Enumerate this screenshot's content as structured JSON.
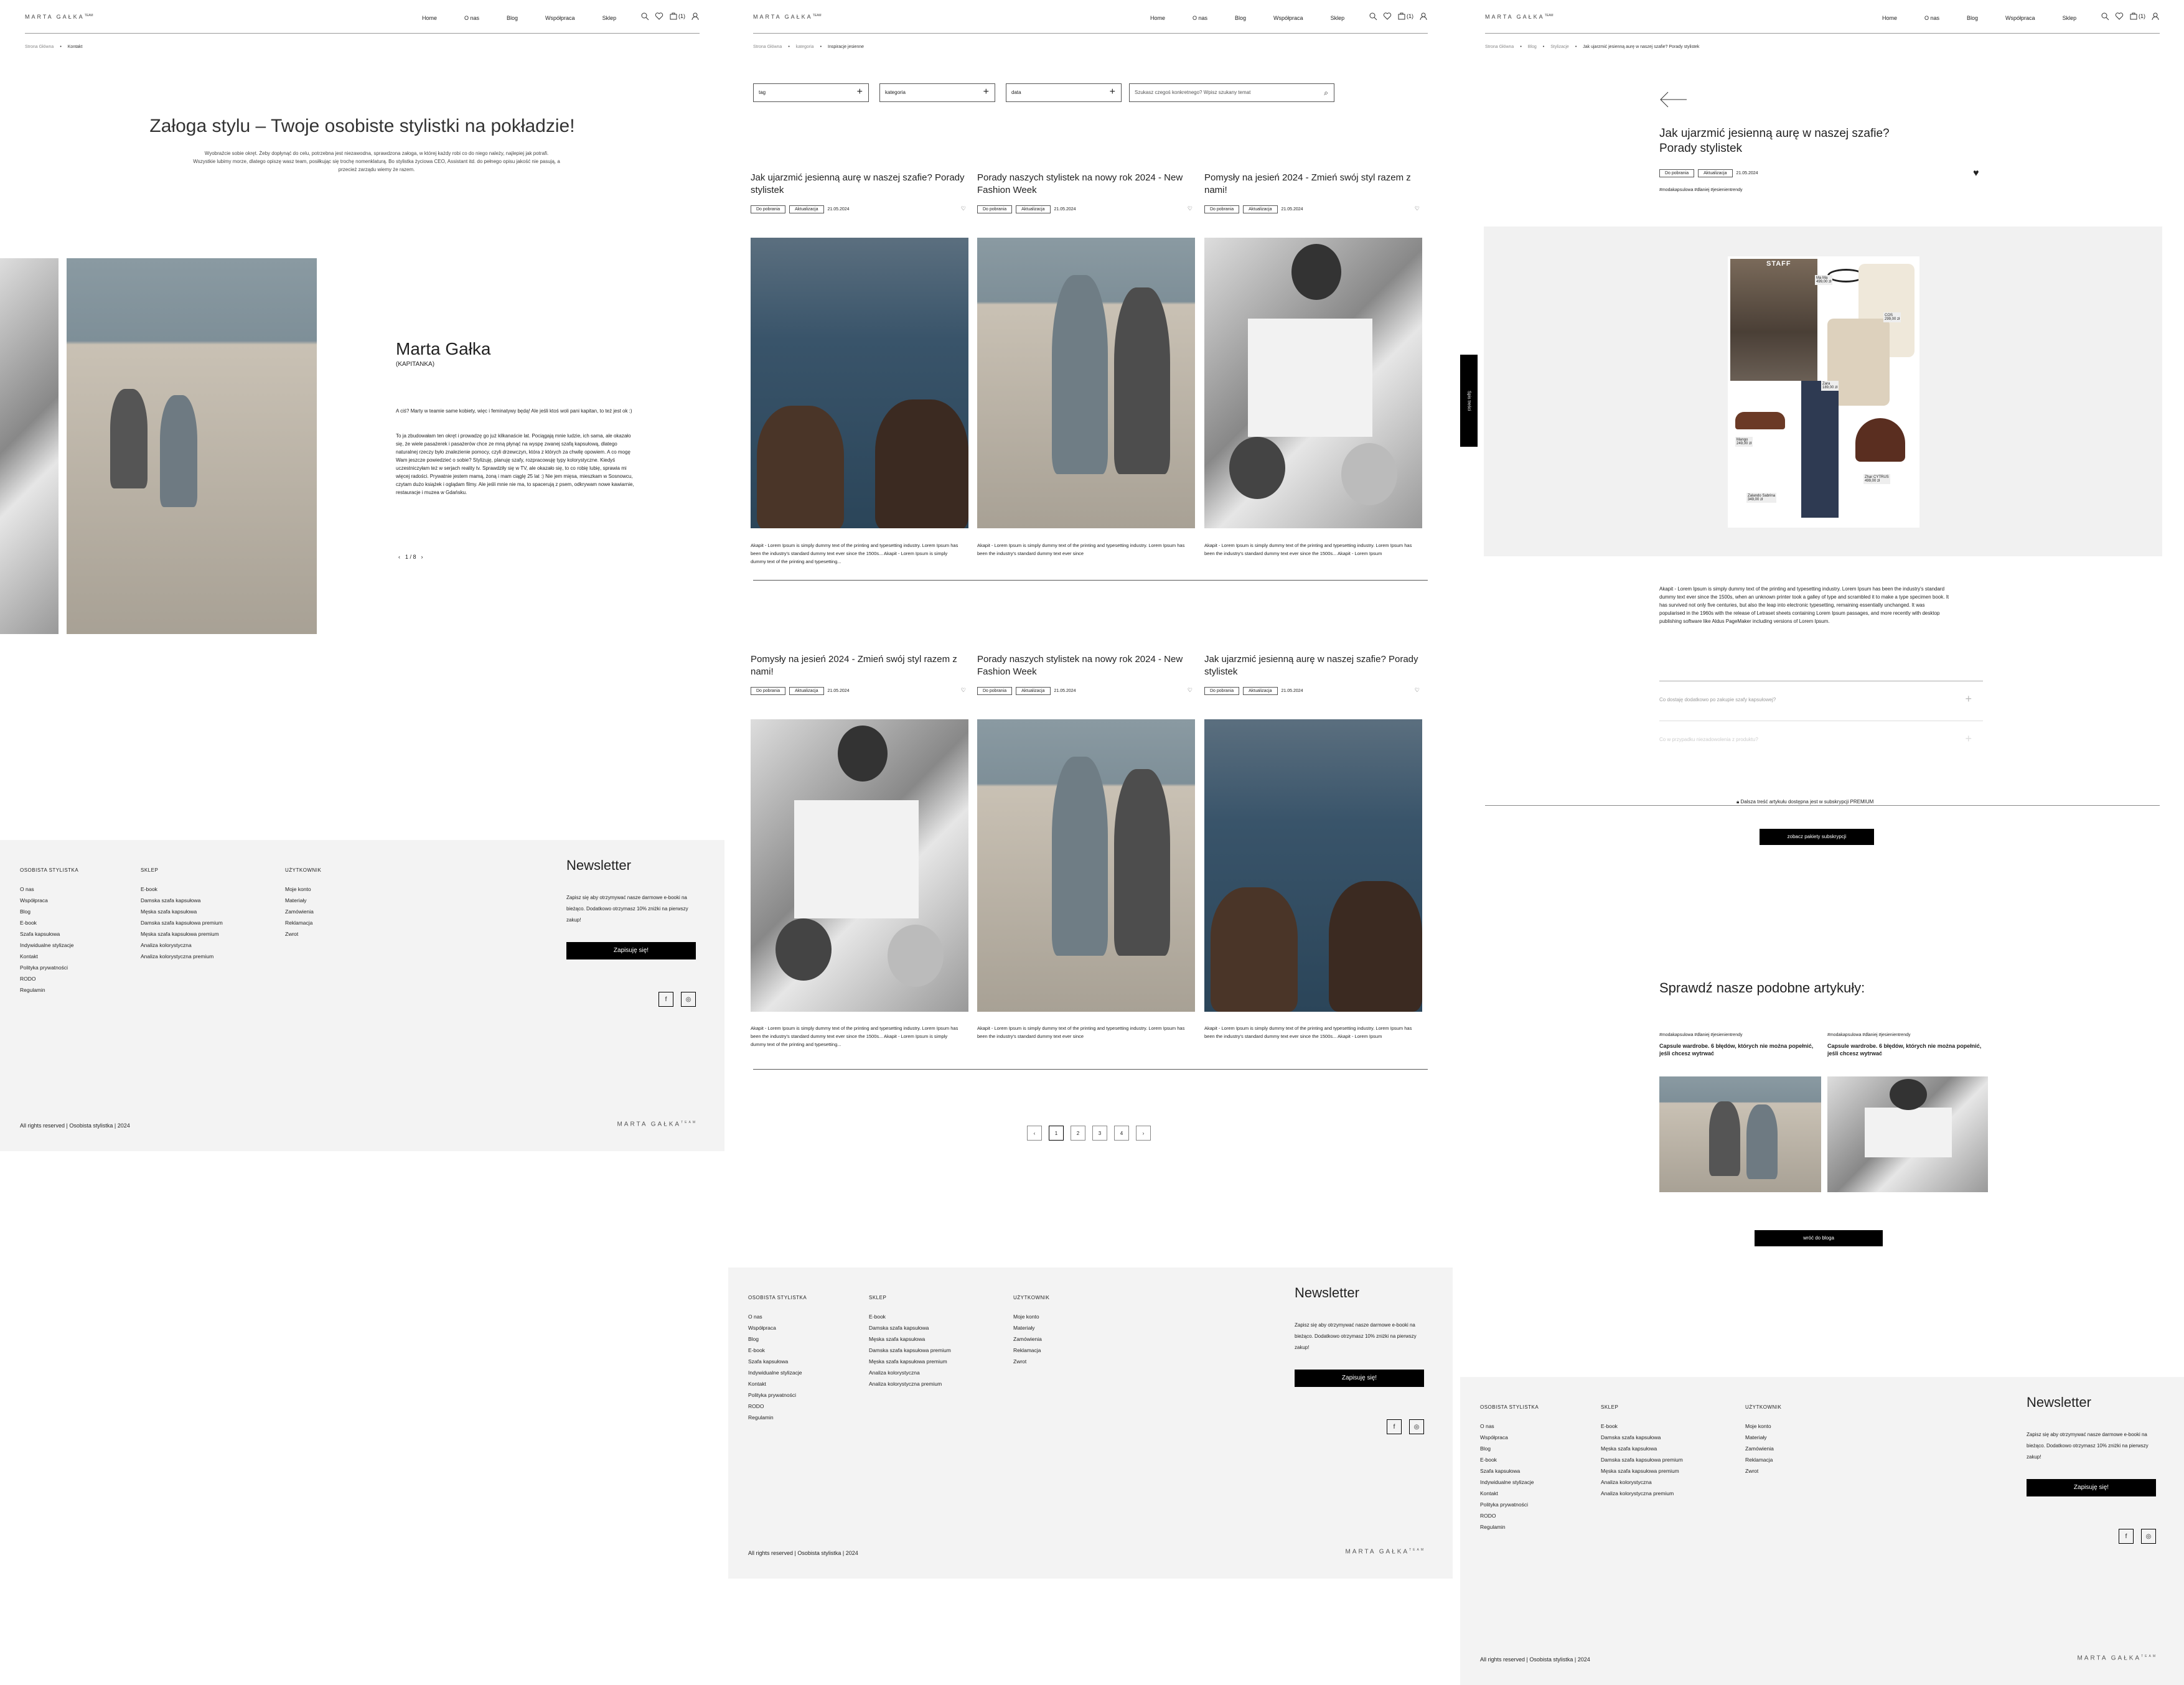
{
  "brand": {
    "logo": "MARTA GAŁKA",
    "logo_sup": "TEAM"
  },
  "nav": [
    "Home",
    "O nas",
    "Blog",
    "Współpraca",
    "Sklep"
  ],
  "cart_count": "(1)",
  "page1": {
    "breadcrumb": [
      "Strona Główna",
      "Kontakt"
    ],
    "title": "Załoga stylu – Twoje osobiste stylistki na pokładzie!",
    "intro": "Wyobraźcie sobie okręt. Żeby dopłynąć do celu, potrzebna jest niezawodna, sprawdzona załoga, w której każdy robi co do niego należy, najlepiej jak potrafi. Wszystkie lubimy morze, dlatego opiszę wasz team, posiłkując się trochę nomenklaturą. Bo stylistka życiowa CEO, Assistant itd. do pełnego opisu jakość nie pasują, a przecież zarządu wiemy że razem.",
    "member_name": "Marta Gałka",
    "member_role": "(KAPITANKA)",
    "bio1": "A ciś? Marty w teamie same kobiety, więc i feminatywy będą! Ale jeśli ktoś woli pani kapitan, to też jest ok :)",
    "bio2": "To ja zbudowałam ten okręt i prowadzę go już kilkanaście lat. Pociągają mnie ludzie, ich sama, ale okazało się, że wiele pasażerek i pasażerów chce ze mną płynąć na wyspę zwanej szafą kapsułową, dlatego naturalnej rzeczy było znalezienie pomocy, czyli drzewczyn, która z których za chwilę opowiem. A co mogę Wam jeszcze powiedzieć o sobie? Stylizuję, planuję szafy, rozpracowuję typy kolorystyczne. Kiedyś uczestniczyłam też w serjach reality tv. Sprawdziły się w TV, ale okazało się, to co robię lubię, sprawia mi więcej radości. Prywatnie jestem mamą, żoną i mam ciąglę 25 lat :) Nie jem mięsa, mieszkam w Sosnowcu, czytam dużo książek i oglądam filmy. Ale jeśli mnie nie ma, to spacerują z psem, odkrywam nowe kawiarnie, restauracje i muzea w Gdańsku.",
    "slider_counter": "1 / 8"
  },
  "footer": {
    "col1_title": "OSOBISTA STYLISTKA",
    "col1": [
      "O nas",
      "Współpraca",
      "Blog",
      "E-book",
      "Szafa kapsułowa",
      "Indywidualne stylizacje",
      "Kontakt",
      "Polityka prywatności",
      "RODO",
      "Regulamin"
    ],
    "col2_title": "SKLEP",
    "col2": [
      "E-book",
      "Damska szafa kapsułowa",
      "Męska szafa kapsułowa",
      "Damska szafa kapsułowa premium",
      "Męska szafa kapsułowa premium",
      "Analiza kolorystyczna",
      "Analiza kolorystyczna premium"
    ],
    "col3_title": "UŻYTKOWNIK",
    "col3": [
      "Moje konto",
      "Materiały",
      "Zamówienia",
      "Reklamacja",
      "Zwrot"
    ],
    "nl_title": "Newsletter",
    "nl_desc": "Zapisz się aby otrzymywać nasze darmowe e-booki na bieżąco. Dodatkowo otrzymasz 10% zniżki na pierwszy zakup!",
    "nl_button": "Zapisuję się!",
    "social_fb": "f",
    "social_ig": "◎",
    "copyright": "All rights reserved | Osobista stylistka | 2024"
  },
  "page2": {
    "breadcrumb": [
      "Strona Główna",
      "kategoria",
      "Inspiracje jesienne"
    ],
    "filters": [
      "tag",
      "kategoria",
      "data"
    ],
    "search_placeholder": "Szukasz czegoś konkretnego? Wpisz szukany temat",
    "tag1": "Do pobrania",
    "tag2": "Aktualizacja",
    "date": "21.05.2024",
    "row1": [
      {
        "title": "Jak ujarzmić jesienną aurę w naszej szafie? Porady stylistek",
        "excerpt": "Akapit - Lorem Ipsum is simply dummy text of the printing and typesetting industry. Lorem Ipsum has been the industry's standard dummy text ever since the 1500s... Akapit - Lorem Ipsum is simply dummy text of the printing and typesetting..."
      },
      {
        "title": "Porady naszych stylistek na nowy rok 2024 - New Fashion Week",
        "excerpt": "Akapit - Lorem Ipsum is simply dummy text of the printing and typesetting industry. Lorem Ipsum has been the industry's standard dummy text ever since"
      },
      {
        "title": "Pomysły na jesień 2024 - Zmień swój styl razem z nami!",
        "excerpt": "Akapit - Lorem Ipsum is simply dummy text of the printing and typesetting industry. Lorem Ipsum has been the industry's standard dummy text ever since the 1500s... Akapit - Lorem Ipsum"
      }
    ],
    "row2": [
      {
        "title": "Pomysły na jesień 2024 - Zmień swój styl razem z nami!",
        "excerpt": "Akapit - Lorem Ipsum is simply dummy text of the printing and typesetting industry. Lorem Ipsum has been the industry's standard dummy text ever since the 1500s... Akapit - Lorem Ipsum is simply dummy text of the printing and typesetting..."
      },
      {
        "title": "Porady naszych stylistek na nowy rok 2024 - New Fashion Week",
        "excerpt": "Akapit - Lorem Ipsum is simply dummy text of the printing and typesetting industry. Lorem Ipsum has been the industry's standard dummy text ever since"
      },
      {
        "title": "Jak ujarzmić jesienną aurę w naszej szafie? Porady stylistek",
        "excerpt": "Akapit - Lorem Ipsum is simply dummy text of the printing and typesetting industry. Lorem Ipsum has been the industry's standard dummy text ever since the 1500s... Akapit - Lorem Ipsum"
      }
    ],
    "pages": [
      "‹",
      "1",
      "2",
      "3",
      "4",
      "›"
    ]
  },
  "page3": {
    "breadcrumb": [
      "Strona Główna",
      "Blog",
      "Stylizacje",
      "Jak ujarzmić jesienną aurę w naszej szafie? Porady stylistek"
    ],
    "title": "Jak ujarzmić jesienną aurę w naszej szafie? Porady stylistek",
    "tag1": "Do pobrania",
    "tag2": "Aktualizacja",
    "date": "21.05.2024",
    "hashtags": "#modakapsulowa #dlaniej #jesienientrendy",
    "side_tab": "Spis treści",
    "collage_labels": [
      "Ma Ma\n499,00 zł",
      "COS\n299,00 zł",
      "Zara\n189,00 zł",
      "Mango\n249,00 zł",
      "Zalando Sabrina\n349,00 zł",
      "Zhar CYTRUS\n499,00 zł"
    ],
    "collage_header": "STAFF",
    "body": "Akapit - Lorem Ipsum is simply dummy text of the printing and typesetting industry. Lorem Ipsum has been the industry's standard dummy text ever since the 1500s, when an unknown printer took a galley of type and scrambled it to make a type specimen book. It has survived not only five centuries, but also the leap into electronic typesetting, remaining essentially unchanged. It was popularised in the 1960s with the release of Letraset sheets containing Lorem Ipsum passages, and more recently with desktop publishing software like Aldus PageMaker including versions of Lorem Ipsum.",
    "faq": [
      "Co dostaję dodatkowo po zakupie szafy kapsułowej?",
      "Co w przypadku niezadowolenia z produktu?"
    ],
    "premium_note": "Dalsza treść artykułu dostępna jest w subskrypcji PREMIUM",
    "premium_button": "zobacz pakiety subskrypcji",
    "related_title": "Sprawdź nasze podobne artykuły:",
    "related": [
      {
        "tags": "#modakapsulowa #dlaniej #jesienientrendy",
        "title": "Capsule wardrobe. 6 błędów, których nie można popełnić, jeśli chcesz wytrwać"
      },
      {
        "tags": "#modakapsulowa #dlaniej #jesienientrendy",
        "title": "Capsule wardrobe. 6 błędów, których nie można popełnić, jeśli chcesz wytrwać"
      }
    ],
    "back_button": "wróć do bloga"
  }
}
